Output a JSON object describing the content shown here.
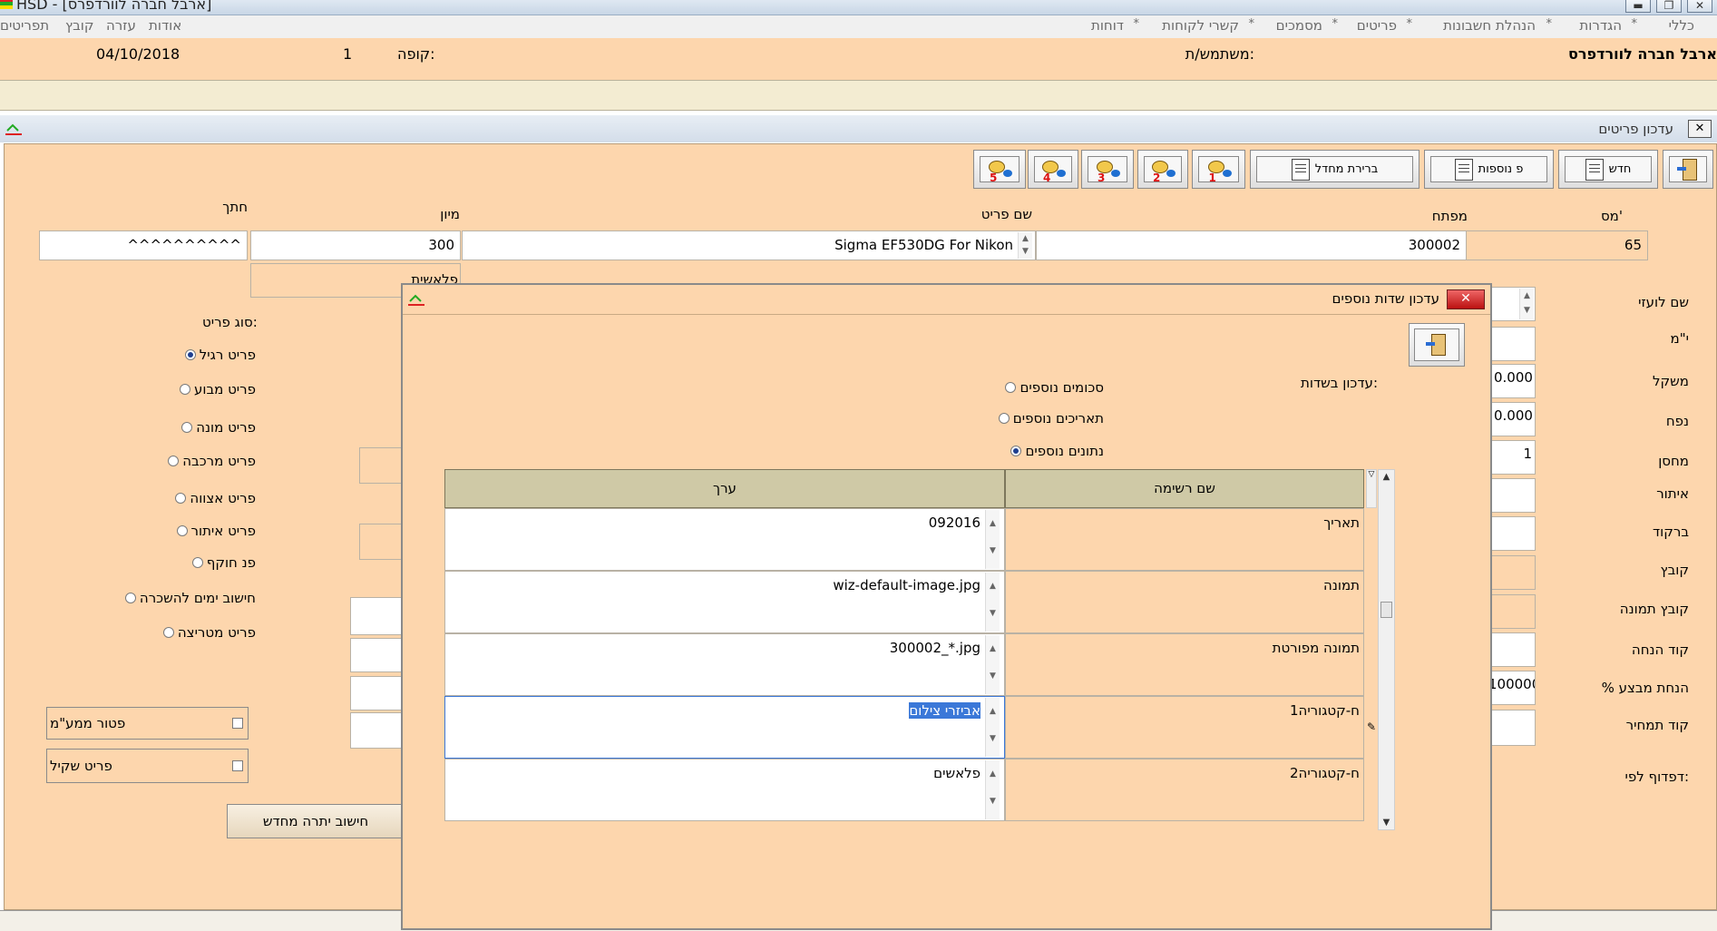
{
  "window": {
    "title": "HSD - [ארבל חברה לוורדפרס]",
    "min": "▬",
    "restore": "❐",
    "close": "✕"
  },
  "menu": {
    "right": [
      "כללי",
      "הגדרות",
      "הנהלת חשבונות",
      "פריטים",
      "מסמכים",
      "קשרי לקוחות",
      "דוחות"
    ],
    "left": [
      "אודות",
      "עזרה",
      "קובץ",
      "תפריטים"
    ],
    "sep": "*"
  },
  "info": {
    "company": "ארבל חברה לוורדפרס",
    "user_label": "משתמש/ת:",
    "register_label": "קופה:",
    "register_value": "1",
    "date": "04/10/2018"
  },
  "main_window": {
    "title": "עדכון פריטים",
    "close": "✕"
  },
  "toolbar": {
    "new_label": "חדש",
    "more_label": "פ נוספות",
    "default_label": "ברירת מחדל",
    "keys": [
      "1",
      "2",
      "3",
      "4",
      "5"
    ]
  },
  "header_labels": {
    "num": "מס'",
    "key": "מפתח",
    "item_name": "שם פריט",
    "sort": "מיון",
    "section": "חתך"
  },
  "item": {
    "num": "65",
    "key": "300002",
    "name": "Sigma EF530DG For Nikon",
    "sort": "300",
    "section": "^^^^^^^^^^",
    "sub_value": "פלאשית"
  },
  "side_labels": {
    "foreign_name": "שם לועזי",
    "unit": "י\"מ",
    "weight": "משקל",
    "volume": "נפח",
    "warehouse": "מחסן",
    "location": "איתור",
    "barcode": "ברקוד",
    "file": "קובץ",
    "image_file": "קובץ תמונה",
    "discount_code": "קוד הנחה",
    "promo_discount": "% הנחת מבצע",
    "price_code": "קוד תמחיר",
    "print_by": "דפדוף לפי:"
  },
  "side_values": {
    "weight": "0.000",
    "volume": "0.000",
    "warehouse": "1",
    "promo_discount": "100000"
  },
  "item_type": {
    "label": "סוג פריט:",
    "options": [
      "פריט רגיל",
      "פריט מבוע",
      "פריט מונה",
      "פריט מרכבה",
      "פריט אצווה",
      "פריט איתור",
      "פנ חוקף",
      "חישוב ימים להשכרה",
      "פריט מטריצה"
    ],
    "selected_index": 0
  },
  "checkboxes": [
    "פטור ממע\"מ",
    "פריט שקיל"
  ],
  "recalc_button": "חישוב יתרה מחדש",
  "dialog": {
    "title": "עדכון שדות נוספים",
    "close": "✕",
    "update_label": "עדכון בשדות:",
    "radios": [
      "סכומים נוספים",
      "תאריכים נוספים",
      "נתונים נוספים"
    ],
    "radio_selected": 2,
    "grid_headers": {
      "name": "שם רשימה",
      "value": "ערך"
    },
    "rows": [
      {
        "name": "תאריך",
        "value": "092016"
      },
      {
        "name": "תמונה",
        "value": "wiz-default-image.jpg"
      },
      {
        "name": "תמונה מפורטת",
        "value": "300002_*.jpg"
      },
      {
        "name": "ח-קטגוריה1",
        "value": "אביזרי צילום"
      },
      {
        "name": "ח-קטגוריה2",
        "value": "פלאשים"
      }
    ],
    "selected_row": 3
  },
  "colors": {
    "form_bg": "#fdd6ad",
    "strip_bg": "#f3ecd2",
    "grid_head": "#cfc9a6",
    "selection": "#3b78d8"
  }
}
